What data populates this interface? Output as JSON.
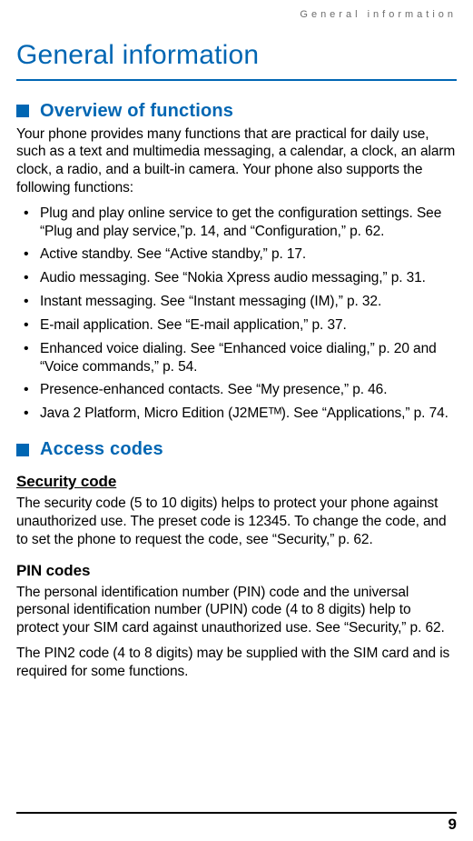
{
  "runningHeader": "General information",
  "title": "General information",
  "sections": {
    "overview": {
      "heading": "Overview of functions",
      "intro": "Your phone provides many functions that are practical for daily use, such as a text and multimedia messaging, a calendar, a clock, an alarm clock, a radio, and a built-in camera. Your phone also supports the following functions:",
      "bullets": [
        "Plug and play online service to get the configuration settings. See “Plug and play service,”p. 14, and “Configuration,” p. 62.",
        "Active standby. See “Active standby,” p. 17.",
        "Audio messaging. See “Nokia Xpress audio messaging,” p. 31.",
        "Instant messaging. See “Instant messaging (IM),” p. 32.",
        "E-mail application. See “E-mail application,” p. 37.",
        "Enhanced voice dialing. See “Enhanced voice dialing,” p. 20 and “Voice commands,” p. 54.",
        "Presence-enhanced contacts. See “My presence,” p. 46.",
        "Java 2 Platform, Micro Edition (J2MEᵀᴹ). See “Applications,” p. 74."
      ]
    },
    "access": {
      "heading": "Access codes",
      "security": {
        "heading": "Security code",
        "text": "The security code (5 to 10 digits) helps to protect your phone against unauthorized use. The preset code is 12345. To change the code, and to set the phone to request the code, see “Security,” p. 62."
      },
      "pin": {
        "heading": "PIN codes",
        "text1": "The personal identification number (PIN) code and the universal personal identification number (UPIN) code (4 to 8 digits) help to protect your SIM card against unauthorized use. See “Security,” p. 62.",
        "text2": "The PIN2 code (4 to 8 digits) may be supplied with the SIM card and is required for some functions."
      }
    }
  },
  "pageNumber": "9"
}
